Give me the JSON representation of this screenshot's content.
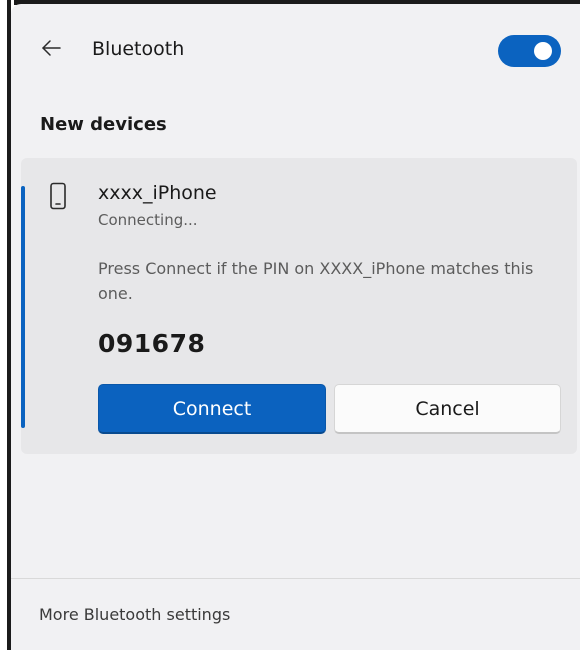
{
  "header": {
    "back_icon": "arrow-left-icon",
    "title": "Bluetooth",
    "toggle_state": "on",
    "accent_color": "#0b63c0"
  },
  "section": {
    "label": "New devices"
  },
  "device": {
    "icon": "phone-icon",
    "name": "xxxx_iPhone",
    "status": "Connecting...",
    "prompt": "Press Connect if the PIN on XXXX_iPhone matches this one.",
    "pin": "091678"
  },
  "actions": {
    "connect_label": "Connect",
    "cancel_label": "Cancel"
  },
  "footer": {
    "link_label": "More Bluetooth settings"
  }
}
